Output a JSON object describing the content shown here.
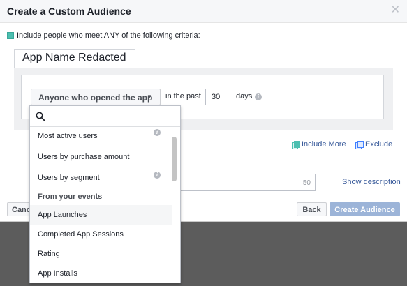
{
  "dialog": {
    "title": "Create a Custom Audience",
    "close_icon": "close-icon"
  },
  "criteria": {
    "text": "Include people who meet ANY of the following criteria:"
  },
  "app_tab": {
    "label": "App Name Redacted"
  },
  "rule": {
    "selected": "Anyone who opened the app",
    "in_the_past_label": "in the past",
    "days_value": "30",
    "days_label": "days"
  },
  "actions": {
    "include_more": "Include More",
    "exclude": "Exclude"
  },
  "name_field": {
    "char_limit": "50"
  },
  "show_description": "Show description",
  "footer": {
    "cancel": "Canc",
    "back": "Back",
    "create": "Create Audience"
  },
  "dropdown": {
    "search_placeholder": "",
    "items": [
      {
        "label": "Most active users",
        "info": true
      },
      {
        "label": "Users by purchase amount",
        "info": false
      },
      {
        "label": "Users by segment",
        "info": true
      }
    ],
    "section_header": "From your events",
    "events": [
      {
        "label": "App Launches",
        "hover": true
      },
      {
        "label": "Completed App Sessions",
        "hover": false
      },
      {
        "label": "Rating",
        "hover": false
      },
      {
        "label": "App Installs",
        "hover": false
      }
    ]
  },
  "colors": {
    "link": "#365899",
    "teal": "#4cbfb0",
    "primary_disabled": "#9cb4d8"
  }
}
